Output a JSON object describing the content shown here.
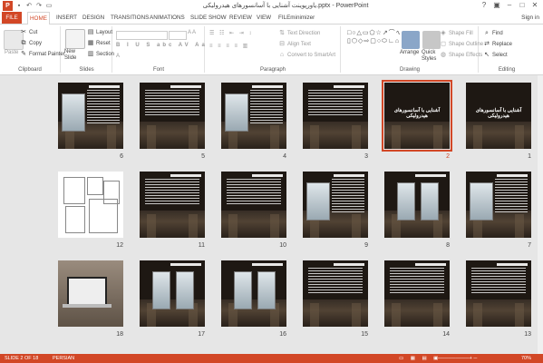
{
  "window": {
    "title": "یاورپوینت آشنایی با آسانسورهای هیدرولیکی.pptx - PowerPoint"
  },
  "tabs": [
    {
      "label": "FILE"
    },
    {
      "label": "HOME"
    },
    {
      "label": "INSERT"
    },
    {
      "label": "DESIGN"
    },
    {
      "label": "TRANSITIONS"
    },
    {
      "label": "ANIMATIONS"
    },
    {
      "label": "SLIDE SHOW"
    },
    {
      "label": "REVIEW"
    },
    {
      "label": "VIEW"
    },
    {
      "label": "FILEminimizer"
    }
  ],
  "signin": "Sign in",
  "ribbon": {
    "clipboard": {
      "label": "Clipboard",
      "paste": "Paste",
      "cut": "Cut",
      "copy": "Copy",
      "format_painter": "Format Painter"
    },
    "slides": {
      "label": "Slides",
      "new_slide": "New Slide",
      "layout": "Layout",
      "reset": "Reset",
      "section": "Section"
    },
    "font": {
      "label": "Font"
    },
    "paragraph": {
      "label": "Paragraph",
      "text_direction": "Text Direction",
      "align_text": "Align Text",
      "convert_smartart": "Convert to SmartArt"
    },
    "drawing": {
      "label": "Drawing",
      "arrange": "Arrange",
      "quick_styles": "Quick Styles",
      "shape_fill": "Shape Fill",
      "shape_outline": "Shape Outline",
      "shape_effects": "Shape Effects"
    },
    "editing": {
      "label": "Editing",
      "find": "Find",
      "replace": "Replace",
      "select": "Select"
    }
  },
  "slides": [
    {
      "num": "1",
      "kind": "title",
      "title": "آشنایی با آسانسورهای هیدرولیکی"
    },
    {
      "num": "2",
      "kind": "title",
      "title": "آشنایی با آسانسورهای هیدرولیکی",
      "selected": true
    },
    {
      "num": "3",
      "kind": "text"
    },
    {
      "num": "4",
      "kind": "textphoto"
    },
    {
      "num": "5",
      "kind": "text"
    },
    {
      "num": "6",
      "kind": "textphoto"
    },
    {
      "num": "7",
      "kind": "textphoto"
    },
    {
      "num": "8",
      "kind": "photo2"
    },
    {
      "num": "9",
      "kind": "textphoto"
    },
    {
      "num": "10",
      "kind": "text"
    },
    {
      "num": "11",
      "kind": "text"
    },
    {
      "num": "12",
      "kind": "plan"
    },
    {
      "num": "13",
      "kind": "text"
    },
    {
      "num": "14",
      "kind": "text"
    },
    {
      "num": "15",
      "kind": "text"
    },
    {
      "num": "16",
      "kind": "photo2"
    },
    {
      "num": "17",
      "kind": "photo2"
    },
    {
      "num": "18",
      "kind": "laptop"
    }
  ],
  "status": {
    "slide": "SLIDE 2 OF 18",
    "language": "PERSIAN",
    "zoom": "70%"
  }
}
